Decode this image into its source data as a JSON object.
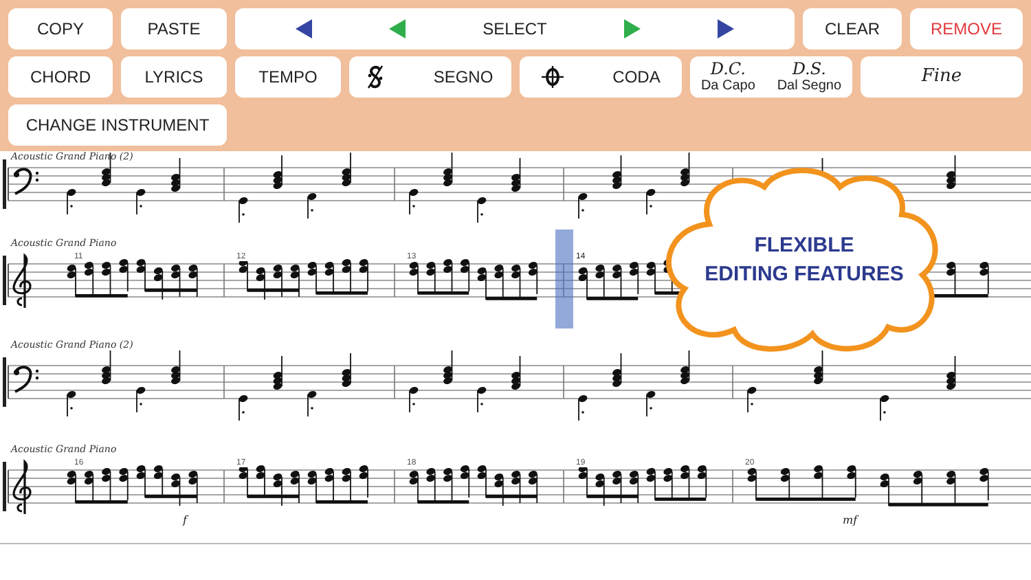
{
  "toolbar": {
    "rows": [
      {
        "buttons": [
          {
            "kind": "text",
            "label": "COPY"
          },
          {
            "kind": "text",
            "label": "PASTE"
          },
          {
            "kind": "select",
            "label": "SELECT"
          },
          {
            "kind": "text",
            "label": "CLEAR"
          },
          {
            "kind": "danger",
            "label": "REMOVE"
          }
        ]
      },
      {
        "buttons": [
          {
            "kind": "text",
            "label": "CHORD"
          },
          {
            "kind": "text",
            "label": "LYRICS"
          },
          {
            "kind": "text",
            "label": "TEMPO"
          },
          {
            "kind": "segno",
            "label": "SEGNO"
          },
          {
            "kind": "coda",
            "label": "CODA"
          },
          {
            "kind": "repeat",
            "items": [
              {
                "title": "D.C.",
                "subtitle": "Da Capo"
              },
              {
                "title": "D.S.",
                "subtitle": "Dal Segno"
              }
            ]
          },
          {
            "kind": "italic",
            "label": "Fine"
          }
        ]
      },
      {
        "buttons": [
          {
            "kind": "text",
            "label": "CHANGE INSTRUMENT"
          }
        ]
      }
    ]
  },
  "score": {
    "staves": [
      {
        "label": "Acoustic Grand Piano (2)",
        "kind": "bass"
      },
      {
        "label": "Acoustic Grand Piano",
        "kind": "treble",
        "measures": [
          {
            "number": "11",
            "selected": false
          },
          {
            "number": "12",
            "selected": false
          },
          {
            "number": "13",
            "selected": false
          },
          {
            "number": "14",
            "selected": true
          }
        ]
      },
      {
        "label": "Acoustic Grand Piano (2)",
        "kind": "bass"
      },
      {
        "label": "Acoustic Grand Piano",
        "kind": "treble",
        "measures": [
          {
            "number": "16",
            "selected": false
          },
          {
            "number": "17",
            "selected": false
          },
          {
            "number": "18",
            "selected": false
          },
          {
            "number": "19",
            "selected": false
          },
          {
            "number": "20",
            "selected": false
          }
        ],
        "dynamics": [
          "f",
          "mf"
        ]
      }
    ]
  },
  "callout": {
    "text": "FLEXIBLE\nEDITING FEATURES"
  }
}
